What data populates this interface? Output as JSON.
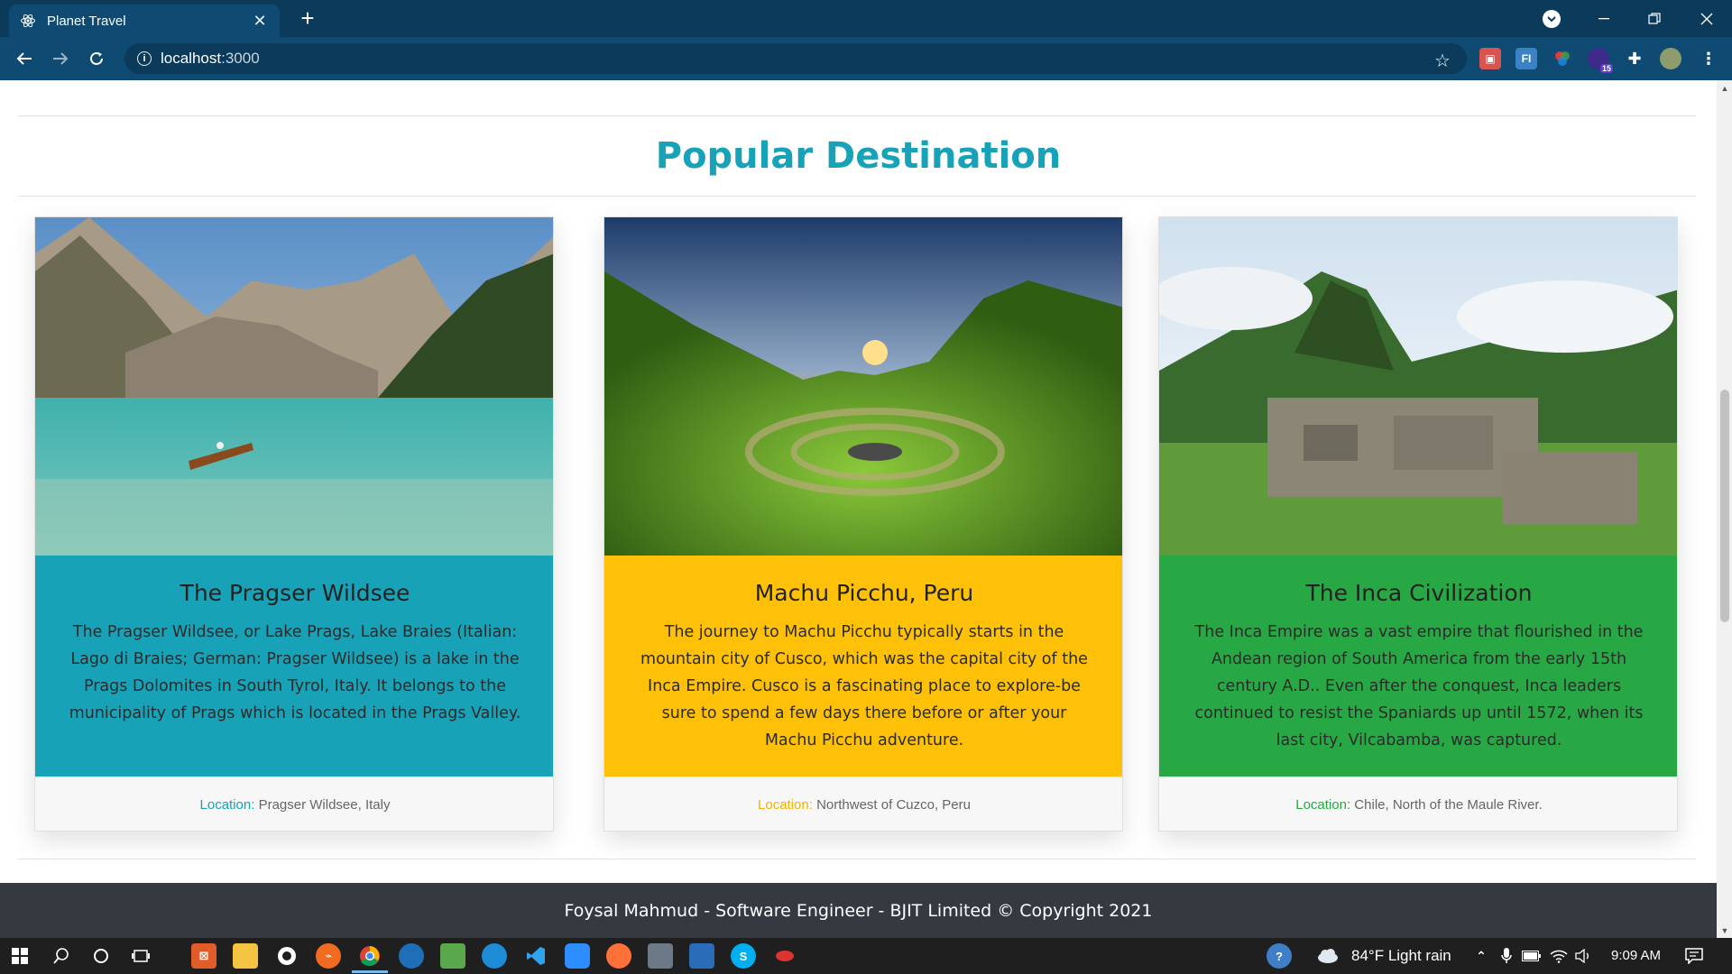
{
  "browser": {
    "tab_title": "Planet Travel",
    "tab_close": "✕",
    "new_tab": "+",
    "url_host": "localhost",
    "url_port": ":3000",
    "extension_badge": "15"
  },
  "section": {
    "title": "Popular Destination"
  },
  "cards": [
    {
      "title": "The Pragser Wildsee",
      "description": "The Pragser Wildsee, or Lake Prags, Lake Braies (Italian: Lago di Braies; German: Pragser Wildsee) is a lake in the Prags Dolomites in South Tyrol, Italy. It belongs to the municipality of Prags which is located in the Prags Valley.",
      "location_label": "Location:",
      "location_value": " Pragser Wildsee, Italy",
      "body_color": "#17a2b8",
      "label_color": "#17a2b8"
    },
    {
      "title": "Machu Picchu, Peru",
      "description": "The journey to Machu Picchu typically starts in the mountain city of Cusco, which was the capital city of the Inca Empire. Cusco is a fascinating place to explore-be sure to spend a few days there before or after your Machu Picchu adventure.",
      "location_label": "Location:",
      "location_value": " Northwest of Cuzco, Peru",
      "body_color": "#ffc107",
      "label_color": "#f0b400"
    },
    {
      "title": "The Inca Civilization",
      "description": "The Inca Empire was a vast empire that flourished in the Andean region of South America from the early 15th century A.D.. Even after the conquest, Inca leaders continued to resist the Spaniards up until 1572, when its last city, Vilcabamba, was captured.",
      "location_label": "Location:",
      "location_value": " Chile, North of the Maule River.",
      "body_color": "#28a745",
      "label_color": "#28a745"
    }
  ],
  "footer": {
    "text": "Foysal Mahmud - Software Engineer - BJIT Limited © Copyright 2021"
  },
  "taskbar": {
    "weather": "84°F  Light rain",
    "time": "9:09 AM"
  }
}
